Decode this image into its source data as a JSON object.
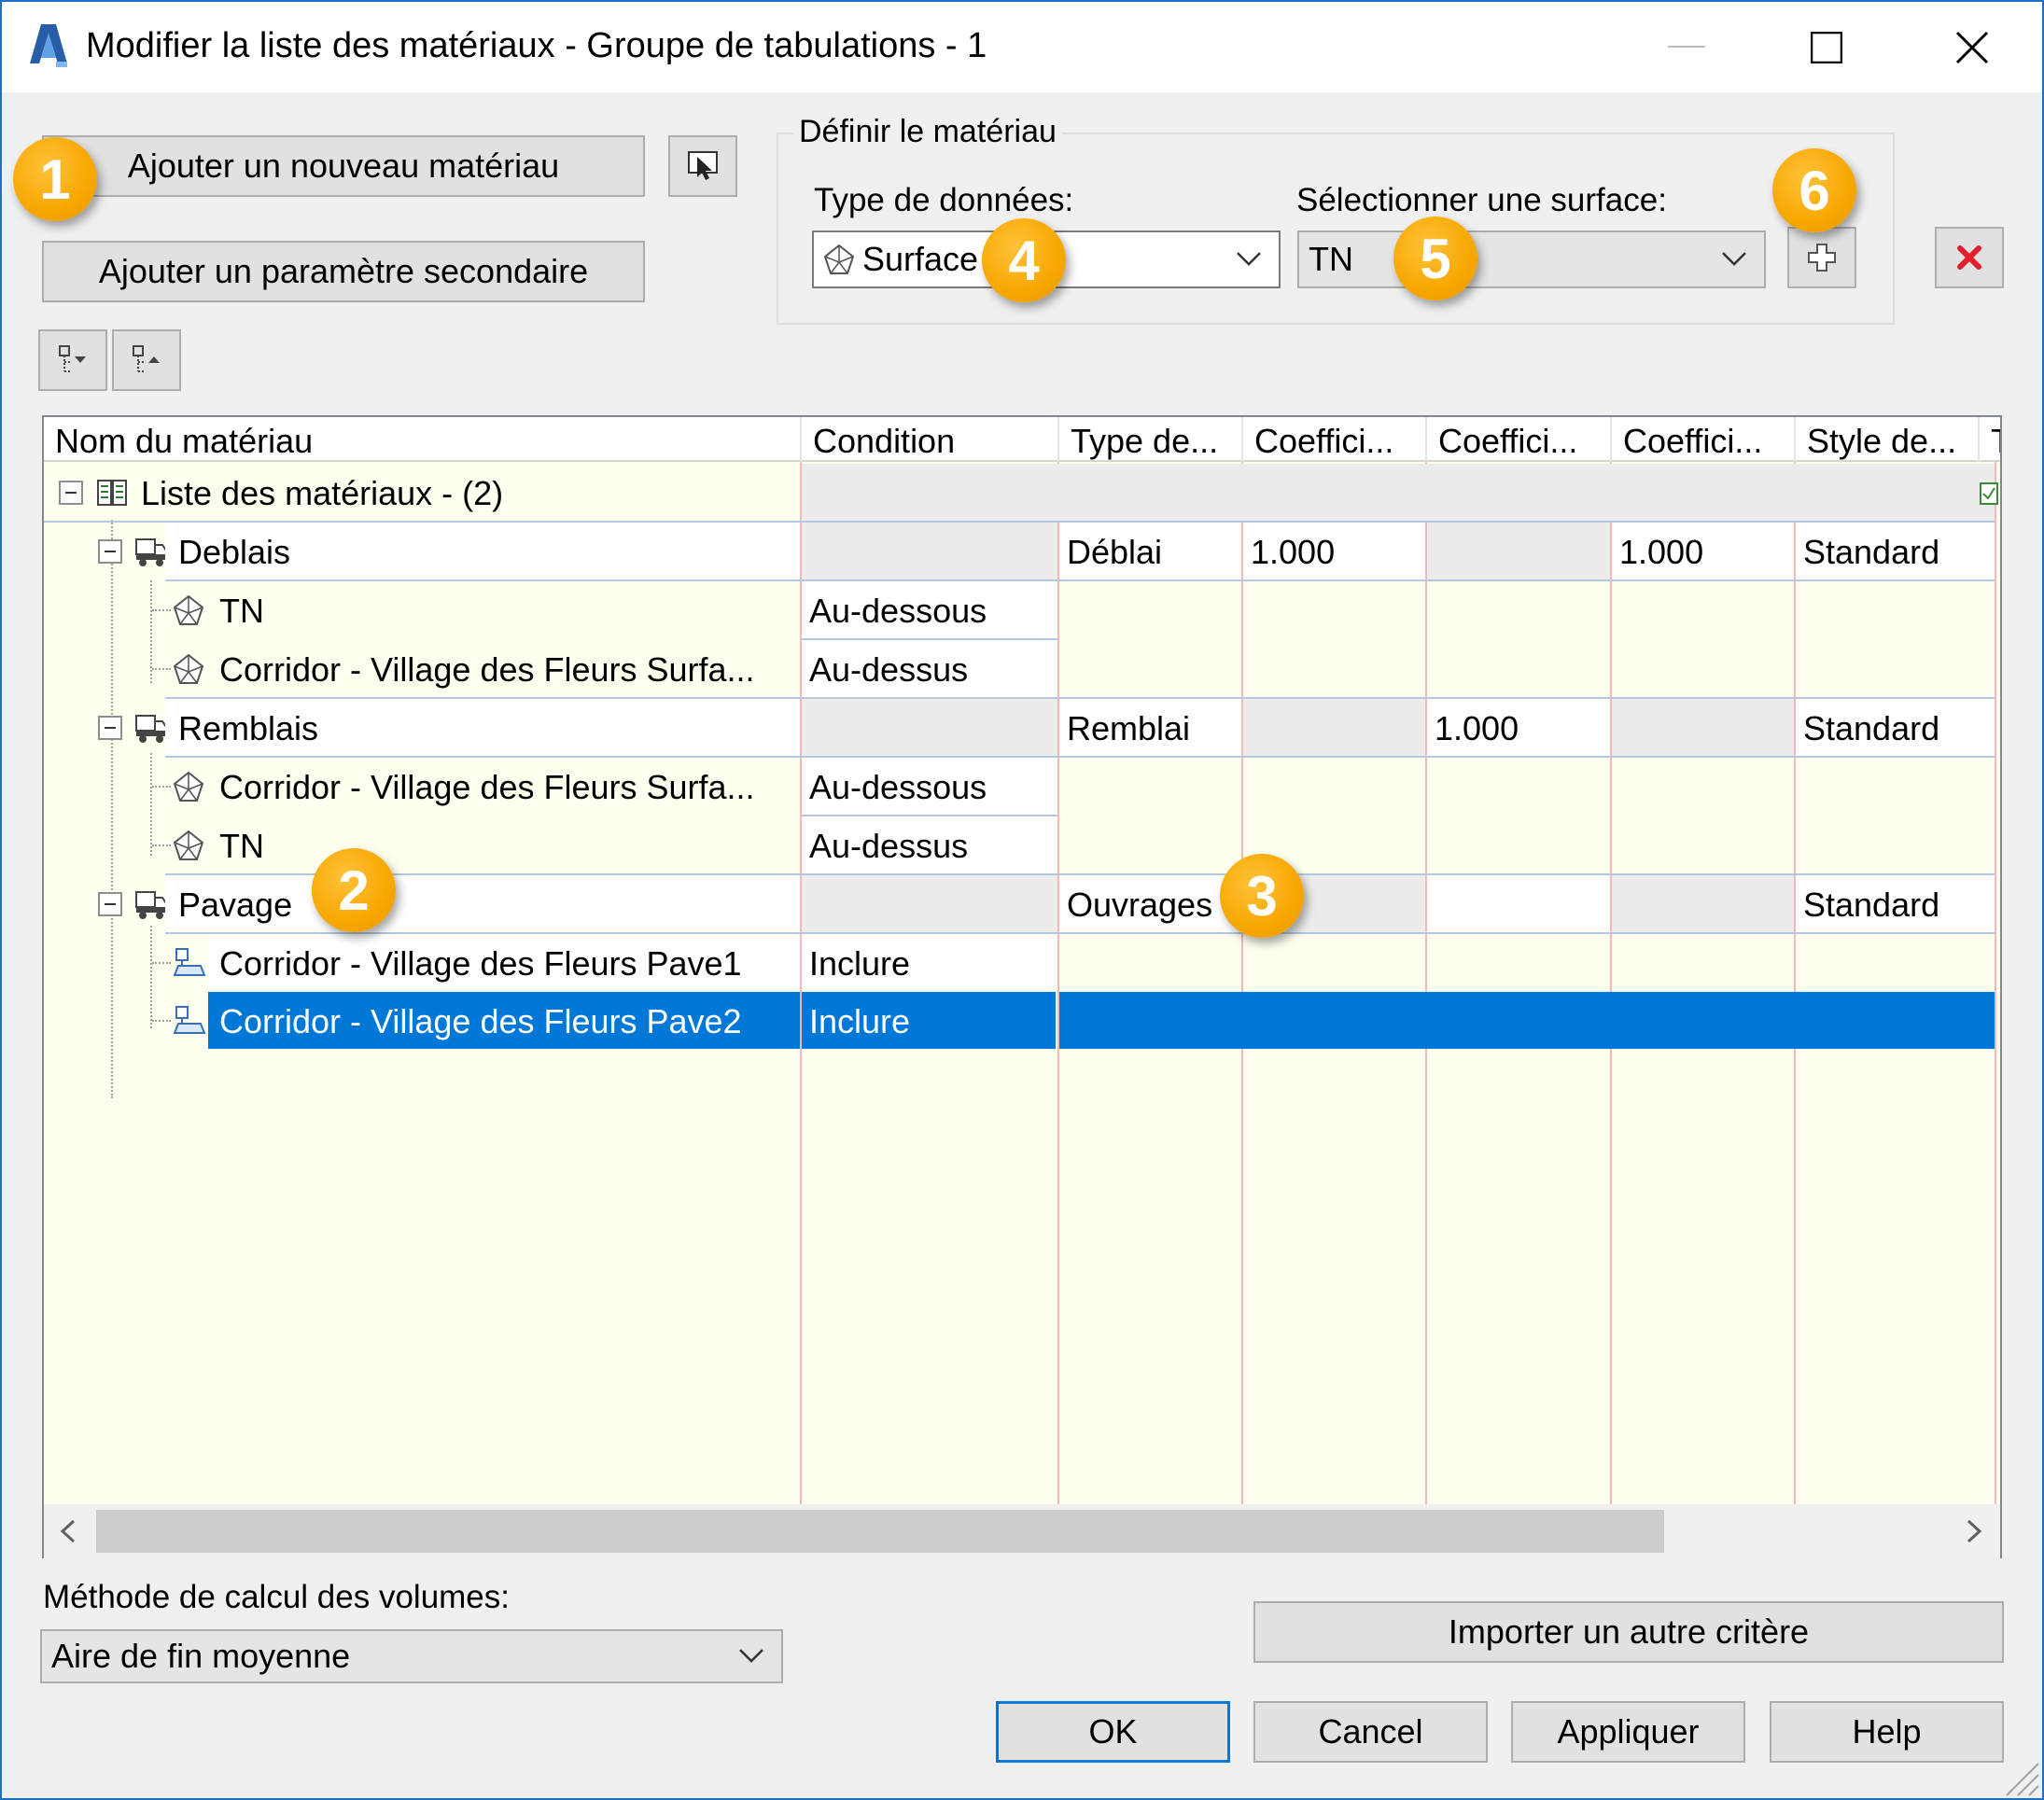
{
  "window": {
    "title": "Modifier la liste des matériaux - Groupe de tabulations - 1"
  },
  "toolbar": {
    "add_material_label": "Ajouter un nouveau matériau",
    "add_secondary_label": "Ajouter un paramètre secondaire"
  },
  "define_material": {
    "group_title": "Définir le matériau",
    "data_type_label": "Type de données:",
    "data_type_value": "Surface",
    "surface_label": "Sélectionner une surface:",
    "surface_value": "TN"
  },
  "callouts": [
    "1",
    "2",
    "3",
    "4",
    "5",
    "6"
  ],
  "grid": {
    "columns": [
      "Nom du matériau",
      "Condition",
      "Type de...",
      "Coeffici...",
      "Coeffici...",
      "Coeffici...",
      "Style de...",
      "T"
    ],
    "root": {
      "name": "Liste des matériaux - (2)"
    },
    "rows": [
      {
        "name": "Deblais",
        "condition": "",
        "type": "Déblai",
        "c1": "1.000",
        "c2": "",
        "c3": "1.000",
        "style": "Standard"
      },
      {
        "name": "TN",
        "condition": "Au-dessous"
      },
      {
        "name": "Corridor - Village des Fleurs Surfa...",
        "condition": "Au-dessus"
      },
      {
        "name": "Remblais",
        "condition": "",
        "type": "Remblai",
        "c1": "",
        "c2": "1.000",
        "c3": "",
        "style": "Standard"
      },
      {
        "name": "Corridor - Village des Fleurs Surfa...",
        "condition": "Au-dessous"
      },
      {
        "name": "TN",
        "condition": "Au-dessus"
      },
      {
        "name": "Pavage",
        "condition": "",
        "type": "Ouvrages",
        "c1": "",
        "c2": "",
        "c3": "",
        "style": "Standard"
      },
      {
        "name": "Corridor - Village des Fleurs Pave1",
        "condition": "Inclure"
      },
      {
        "name": "Corridor - Village des Fleurs Pave2",
        "condition": "Inclure"
      }
    ]
  },
  "volume": {
    "label": "Méthode de calcul des volumes:",
    "value": "Aire de fin moyenne"
  },
  "buttons": {
    "import": "Importer un autre critère",
    "ok": "OK",
    "cancel": "Cancel",
    "apply": "Appliquer",
    "help": "Help"
  },
  "colors": {
    "accent": "#0078d7",
    "callout": "#f7a700",
    "grid_bg": "#fffff0",
    "delete": "#e0202a"
  }
}
